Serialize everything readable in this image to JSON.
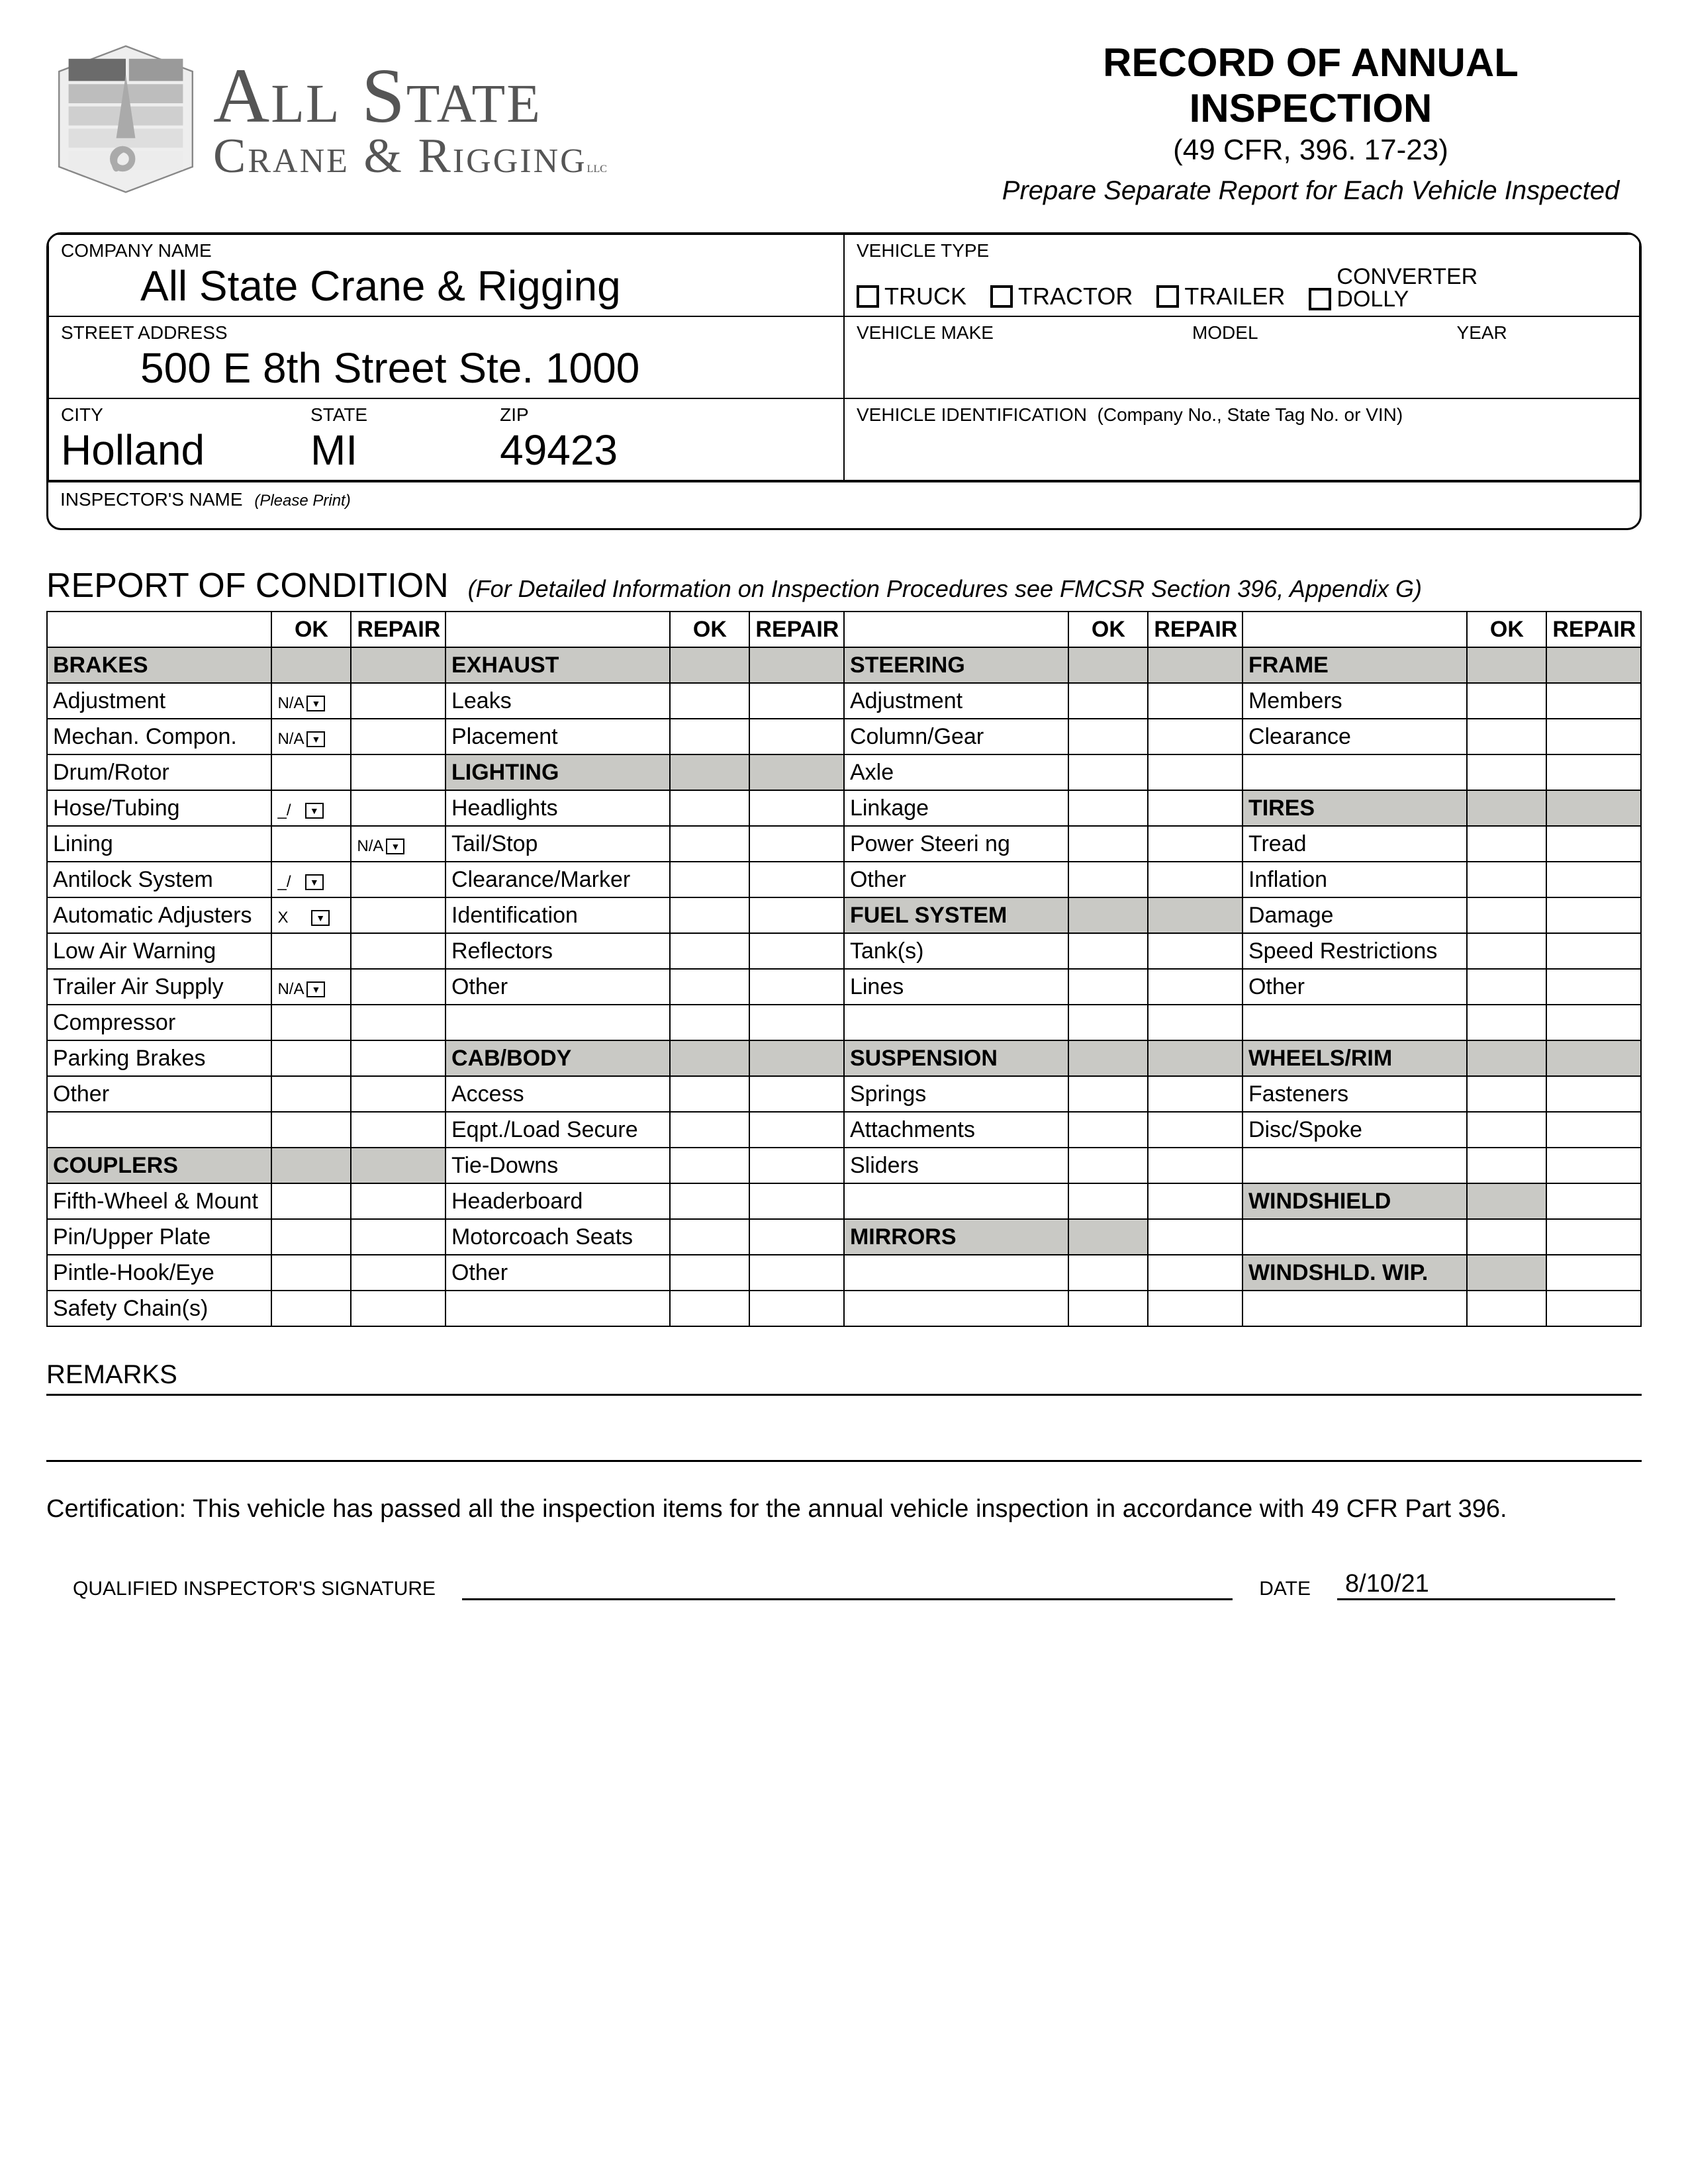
{
  "header": {
    "logo_line1": "All State",
    "logo_line2": "Crane & Rigging",
    "logo_suffix": "LLC",
    "title1": "RECORD OF ANNUAL INSPECTION",
    "title2": "(49 CFR, 396. 17-23)",
    "title3": "Prepare Separate Report for Each Vehicle Inspected"
  },
  "info": {
    "company_label": "COMPANY NAME",
    "company_value": "All State Crane & Rigging",
    "street_label": "STREET ADDRESS",
    "street_value": "500 E 8th Street Ste. 1000",
    "city_label": "CITY",
    "city_value": "Holland",
    "state_label": "STATE",
    "state_value": "MI",
    "zip_label": "ZIP",
    "zip_value": "49423",
    "vehicle_type_label": "VEHICLE TYPE",
    "vt_truck": "TRUCK",
    "vt_tractor": "TRACTOR",
    "vt_trailer": "TRAILER",
    "vt_conv": "CONVERTER",
    "vt_dolly": "DOLLY",
    "vehicle_make_label": "VEHICLE MAKE",
    "model_label": "MODEL",
    "year_label": "YEAR",
    "vin_label": "VEHICLE IDENTIFICATION",
    "vin_hint": "(Company No., State Tag No. or VIN)",
    "inspector_label": "INSPECTOR'S NAME",
    "please_print": "(Please Print)"
  },
  "roc": {
    "heading": "REPORT OF CONDITION",
    "sub": "(For Detailed Information on Inspection Procedures see FMCSR Section 396, Appendix G)"
  },
  "cols": {
    "ok": "OK",
    "repair": "REPAIR"
  },
  "sections": {
    "brakes": "BRAKES",
    "couplers": "COUPLERS",
    "exhaust": "EXHAUST",
    "lighting": "LIGHTING",
    "cabbody": "CAB/BODY",
    "steering": "STEERING",
    "fuel": "FUEL SYSTEM",
    "suspension": "SUSPENSION",
    "mirrors": "MIRRORS",
    "frame": "FRAME",
    "tires": "TIRES",
    "wheels": "WHEELS/RIM",
    "windshield": "WINDSHIELD",
    "wipers": "WINDSHLD. WIP."
  },
  "items": {
    "adjustment": "Adjustment",
    "mechan": "Mechan. Compon.",
    "drum": "Drum/Rotor",
    "hose": "Hose/Tubing",
    "lining": "Lining",
    "antilock": "Antilock System",
    "autoadj": "Automatic Adjusters",
    "lowair": "Low Air Warning",
    "trailerair": "Trailer Air Supply",
    "compressor": "Compressor",
    "parking": "Parking Brakes",
    "other": "Other",
    "fifth": "Fifth-Wheel & Mount",
    "pin": "Pin/Upper Plate",
    "pintle": "Pintle-Hook/Eye",
    "chains": "Safety Chain(s)",
    "leaks": "Leaks",
    "placement": "Placement",
    "headlights": "Headlights",
    "tailstop": "Tail/Stop",
    "clearmark": "Clearance/Marker",
    "ident": "Identification",
    "reflectors": "Reflectors",
    "access": "Access",
    "eqpt": "Eqpt./Load Secure",
    "tiedowns": "Tie-Downs",
    "headerboard": "Headerboard",
    "motorseats": "Motorcoach Seats",
    "column": "Column/Gear",
    "axle": "Axle",
    "linkage": "Linkage",
    "powersteer": "Power Steeri ng",
    "tanks": "Tank(s)",
    "lines": "Lines",
    "springs": "Springs",
    "attachments": "Attachments",
    "sliders": "Sliders",
    "members": "Members",
    "clearance": "Clearance",
    "tread": "Tread",
    "inflation": "Inflation",
    "damage": "Damage",
    "speedrest": "Speed Restrictions",
    "fasteners": "Fasteners",
    "discspoke": "Disc/Spoke"
  },
  "okvals": {
    "na": "N/A",
    "check": "_/",
    "x": "X"
  },
  "remarks": {
    "label": "REMARKS",
    "cert": "Certification: This vehicle has passed all the inspection items for the annual vehicle inspection in accordance with 49 CFR Part 396.",
    "sig_label": "QUALIFIED INSPECTOR'S SIGNATURE",
    "date_label": "DATE",
    "date_value": "8/10/21"
  }
}
